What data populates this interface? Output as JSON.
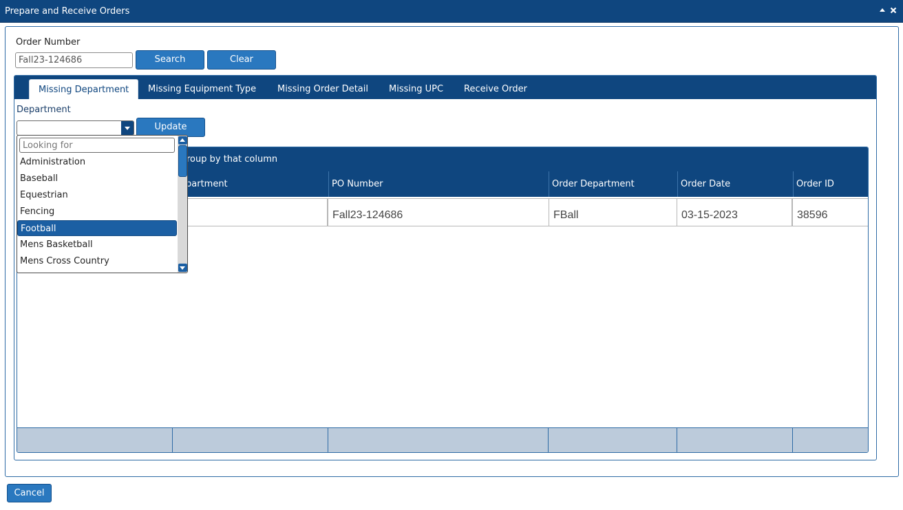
{
  "window": {
    "title": "Prepare and Receive Orders",
    "minimize_icon": "collapse-up-icon",
    "close_icon": "close-icon"
  },
  "order": {
    "label": "Order Number",
    "value": "Fall23-124686",
    "search_label": "Search",
    "clear_label": "Clear"
  },
  "tabs": [
    {
      "label": "Missing Department",
      "active": true
    },
    {
      "label": "Missing Equipment Type",
      "active": false
    },
    {
      "label": "Missing Order Detail",
      "active": false
    },
    {
      "label": "Missing UPC",
      "active": false
    },
    {
      "label": "Receive Order",
      "active": false
    }
  ],
  "department": {
    "label": "Department",
    "value": "",
    "update_label": "Update",
    "dropdown": {
      "search_placeholder": "Looking for",
      "items": [
        "Administration",
        "Baseball",
        "Equestrian",
        "Fencing",
        "Football",
        "Mens Basketball",
        "Mens Cross Country"
      ],
      "selected": "Football"
    }
  },
  "grid": {
    "group_hint": "roup by that column",
    "columns": [
      "partment",
      "PO Number",
      "Order Department",
      "Order Date",
      "Order ID"
    ],
    "rows": [
      [
        "",
        "Fall23-124686",
        "FBall",
        "03-15-2023",
        "38596"
      ]
    ]
  },
  "footer": {
    "cancel_label": "Cancel"
  },
  "colors": {
    "header_navy": "#0f467f",
    "button_blue": "#2a78bf",
    "selected_item": "#1b5fa3",
    "footer_gray": "#bccbdb"
  }
}
